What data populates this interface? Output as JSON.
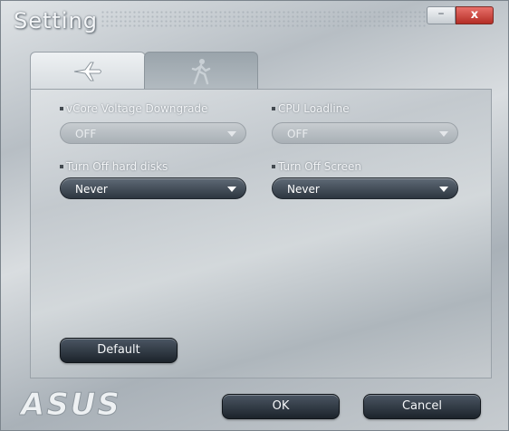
{
  "window": {
    "title": "Setting"
  },
  "titlebar": {
    "minimize_glyph": "–",
    "close_glyph": "x"
  },
  "tabs": [
    {
      "name": "airplane-icon",
      "selected": true
    },
    {
      "name": "walking-person-icon",
      "selected": false
    }
  ],
  "settings": {
    "vcore": {
      "label": "vCore Voltage Downgrade",
      "value": "OFF",
      "enabled": false
    },
    "cpu_loadline": {
      "label": "CPU Loadline",
      "value": "OFF",
      "enabled": false
    },
    "hard_disks": {
      "label": "Turn Off hard disks",
      "value": "Never",
      "enabled": true
    },
    "screen": {
      "label": "Turn Off Screen",
      "value": "Never",
      "enabled": true
    }
  },
  "buttons": {
    "default": "Default",
    "ok": "OK",
    "cancel": "Cancel"
  },
  "brand": {
    "logo": "ASUS"
  },
  "colors": {
    "close": "#c0392b",
    "dark_button": "#2a323b"
  }
}
